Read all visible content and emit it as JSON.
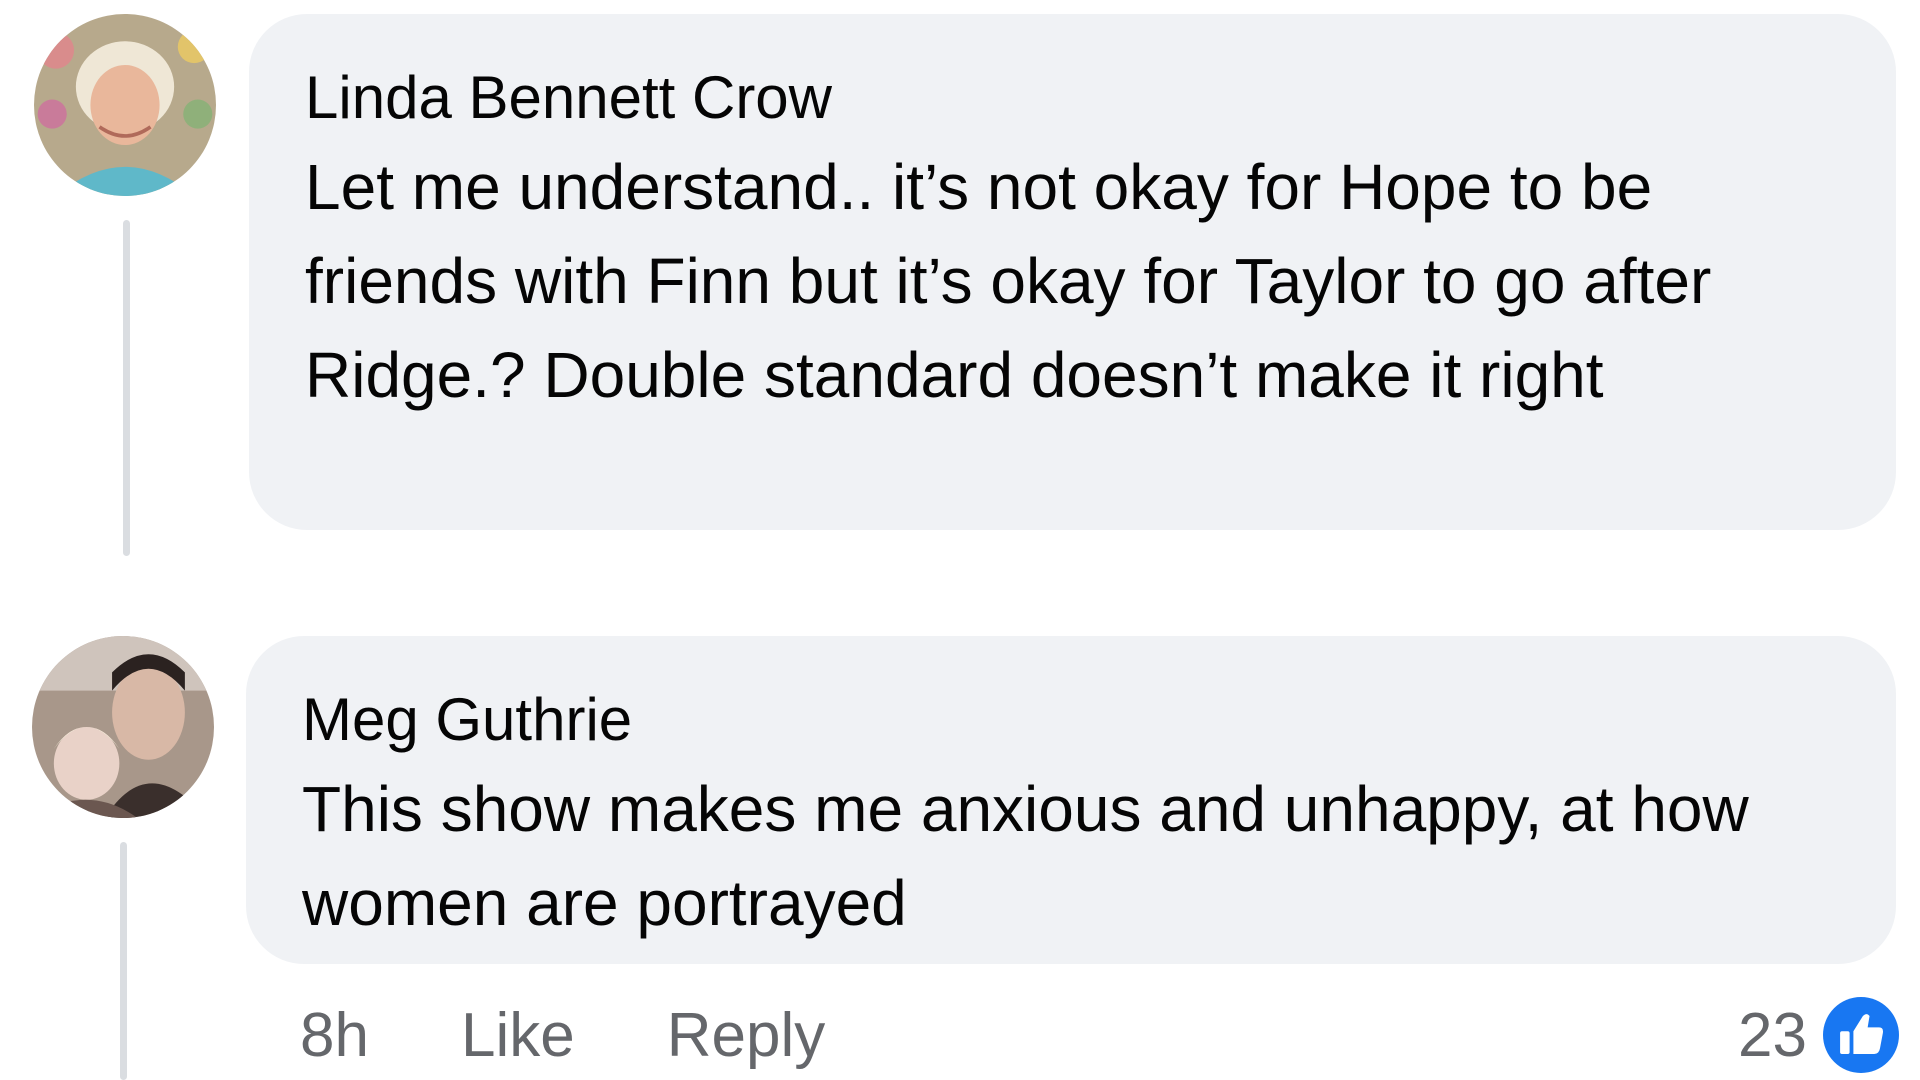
{
  "comments": [
    {
      "author": "Linda Bennett Crow",
      "text": "Let me understand.. it’s not okay for Hope to be friends with Finn but it’s okay for Taylor to go after Ridge.?  Double standard doesn’t make it right"
    },
    {
      "author": "Meg Guthrie",
      "text": "This show makes me anxious and unhappy, at how women are portrayed",
      "time": "8h",
      "like_label": "Like",
      "reply_label": "Reply",
      "reaction_count": "23",
      "reaction_icon": "thumbs-up-icon"
    }
  ],
  "colors": {
    "bubble": "#f0f2f5",
    "secondary_text": "#65676b",
    "like_blue": "#1877f2"
  }
}
